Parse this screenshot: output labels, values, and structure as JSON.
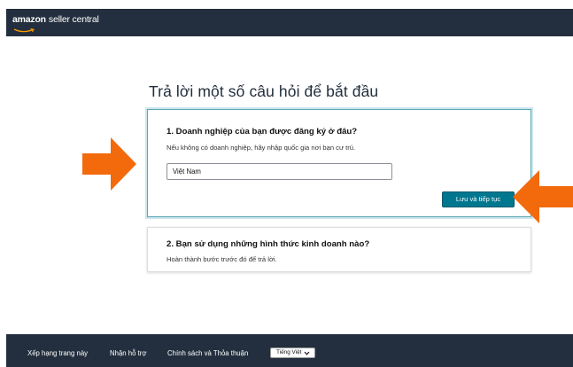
{
  "header": {
    "logo_brand": "amazon",
    "logo_product": "seller central"
  },
  "page": {
    "heading": "Trả lời một số câu hỏi để bắt đầu"
  },
  "step1": {
    "title": "1. Doanh nghiệp của bạn được đăng ký ở đâu?",
    "subtitle": "Nếu không có doanh nghiệp, hãy nhập quốc gia nơi bạn cư trú.",
    "country_value": "Việt Nam",
    "save_label": "Lưu và tiếp tục"
  },
  "step2": {
    "title": "2. Bạn sử dụng những hình thức kinh doanh nào?",
    "subtitle": "Hoàn thành bước trước đó để trả lời."
  },
  "footer": {
    "links": [
      "Xếp hạng trang này",
      "Nhận hỗ trợ",
      "Chính sách và Thỏa thuận"
    ],
    "language": "Tiếng Việt"
  },
  "colors": {
    "header_bg": "#232f3e",
    "accent_button": "#00778f",
    "active_card_border": "#5aa6b4",
    "annotation_arrow": "#f26a0c"
  },
  "icons": [
    "amazon-smile-icon",
    "chevron-down-icon",
    "orange-arrow-right-icon",
    "orange-arrow-left-icon"
  ]
}
